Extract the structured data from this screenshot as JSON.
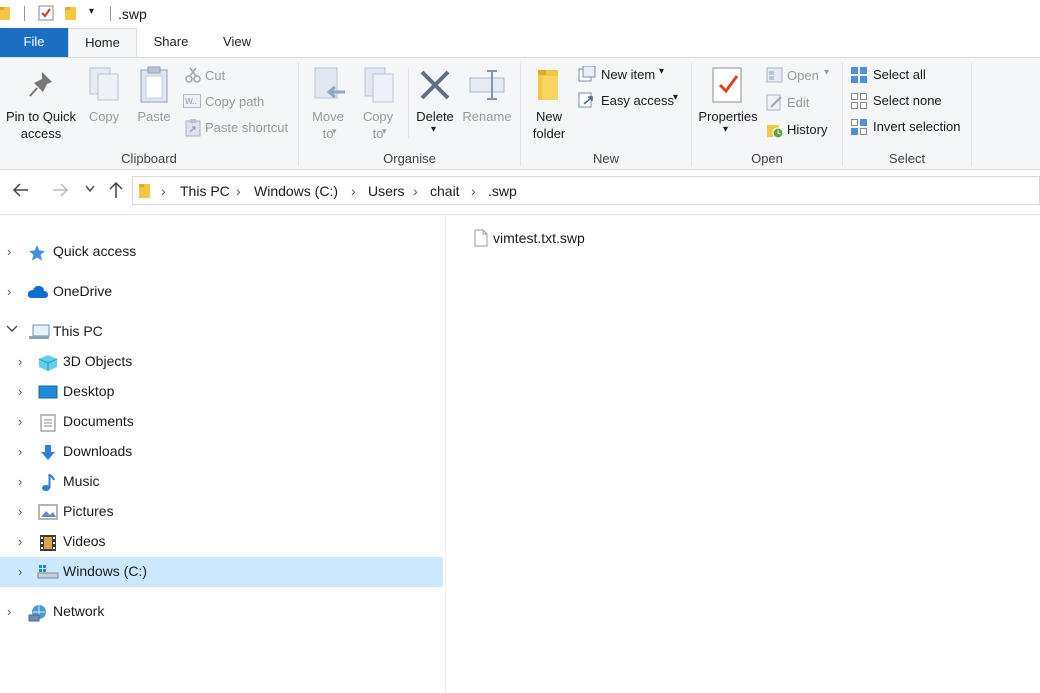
{
  "titlebar": {
    "path_text": ".swp"
  },
  "tabs": [
    {
      "label": "File"
    },
    {
      "label": "Home"
    },
    {
      "label": "Share"
    },
    {
      "label": "View"
    }
  ],
  "ribbon": {
    "clipboard": {
      "pin_label_1": "Pin to Quick",
      "pin_label_2": "access",
      "copy_label": "Copy",
      "paste_label": "Paste",
      "cut_label": "Cut",
      "copy_path_label": "Copy path",
      "paste_shortcut_label": "Paste shortcut",
      "group_label": "Clipboard"
    },
    "organise": {
      "move_label_1": "Move",
      "move_label_2": "to",
      "copy_label_1": "Copy",
      "copy_label_2": "to",
      "delete_label": "Delete",
      "rename_label": "Rename",
      "group_label": "Organise"
    },
    "new": {
      "new_folder_1": "New",
      "new_folder_2": "folder",
      "new_item_label": "New item",
      "easy_access_label": "Easy access",
      "group_label": "New"
    },
    "open": {
      "properties_label": "Properties",
      "open_label": "Open",
      "edit_label": "Edit",
      "history_label": "History",
      "group_label": "Open"
    },
    "select": {
      "select_all_label": "Select all",
      "select_none_label": "Select none",
      "invert_label": "Invert selection",
      "group_label": "Select"
    }
  },
  "address": {
    "crumbs": [
      "This PC",
      "Windows (C:)",
      "Users",
      "chait",
      ".swp"
    ]
  },
  "nav": {
    "items": [
      {
        "label": "Quick access"
      },
      {
        "label": "OneDrive"
      },
      {
        "label": "This PC"
      },
      {
        "label": "3D Objects"
      },
      {
        "label": "Desktop"
      },
      {
        "label": "Documents"
      },
      {
        "label": "Downloads"
      },
      {
        "label": "Music"
      },
      {
        "label": "Pictures"
      },
      {
        "label": "Videos"
      },
      {
        "label": "Windows (C:)"
      },
      {
        "label": "Network"
      }
    ]
  },
  "files": [
    {
      "name": "vimtest.txt.swp"
    }
  ],
  "colors": {
    "file_tab": "#1b6ec2",
    "selection": "#cce8ff",
    "ribbon_bg": "#f5f6f7"
  }
}
